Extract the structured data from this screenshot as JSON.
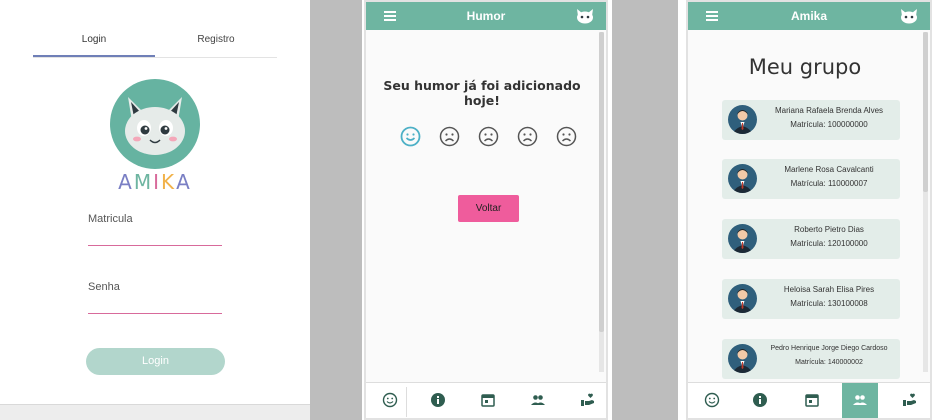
{
  "login": {
    "tabs": [
      {
        "label": "Login"
      },
      {
        "label": "Registro"
      }
    ],
    "brand": {
      "letters": [
        "A",
        "M",
        "I",
        "K",
        "A"
      ],
      "colors": [
        "#7a7fc4",
        "#6eb5a1",
        "#d86a9b",
        "#f1b24a",
        "#7a7fc4"
      ]
    },
    "fields": [
      {
        "label": "Matricula"
      },
      {
        "label": "Senha"
      }
    ],
    "submit_label": "Login",
    "accent_color": "#d86a9b"
  },
  "mood": {
    "app_title": "Humor",
    "message": "Seu humor já foi adicionado hoje!",
    "faces": [
      {
        "icon": "smiling-face-icon",
        "selected": true
      },
      {
        "icon": "frowning-face-icon",
        "selected": false
      },
      {
        "icon": "frowning-face-icon",
        "selected": false
      },
      {
        "icon": "frowning-face-icon",
        "selected": false
      },
      {
        "icon": "frowning-face-icon",
        "selected": false
      }
    ],
    "back_label": "Voltar",
    "nav": [
      {
        "icon": "mood-icon",
        "active": false
      },
      {
        "icon": "info-icon",
        "active": false
      },
      {
        "icon": "calendar-icon",
        "active": false
      },
      {
        "icon": "group-icon",
        "active": false
      },
      {
        "icon": "care-icon",
        "active": false
      }
    ]
  },
  "group": {
    "app_title": "Amika",
    "heading": "Meu grupo",
    "members": [
      {
        "name": "Mariana Rafaela Brenda Alves",
        "enrollment": "Matrícula: 100000000"
      },
      {
        "name": "Marlene Rosa Cavalcanti",
        "enrollment": "Matrícula: 110000007"
      },
      {
        "name": "Roberto Pietro Dias",
        "enrollment": "Matrícula: 120100000"
      },
      {
        "name": "Heloisa Sarah Elisa Pires",
        "enrollment": "Matrícula: 130100008"
      },
      {
        "name": "Pedro Henrique Jorge Diego Cardoso",
        "enrollment": "Matrícula: 140000002"
      }
    ],
    "nav": [
      {
        "icon": "mood-icon",
        "active": false
      },
      {
        "icon": "info-icon",
        "active": false
      },
      {
        "icon": "calendar-icon",
        "active": false
      },
      {
        "icon": "group-icon",
        "active": true
      },
      {
        "icon": "care-icon",
        "active": false
      }
    ]
  },
  "colors": {
    "app_bar": "#6eb5a1",
    "button_pink": "#ef5c9c",
    "login_button": "#b2d6cc",
    "card_bg": "#e3ede9"
  }
}
